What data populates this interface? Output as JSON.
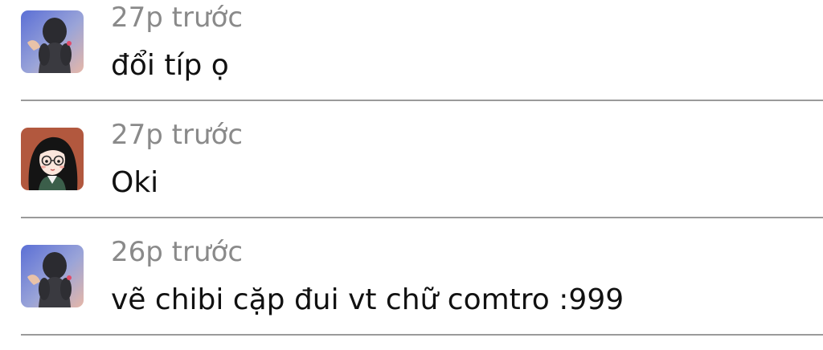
{
  "comments": [
    {
      "avatar": "user-photo-avatar",
      "time": "27p trước",
      "text": "đổi típ ọ"
    },
    {
      "avatar": "cartoon-girl-avatar",
      "time": "27p trước",
      "text": "Oki"
    },
    {
      "avatar": "user-photo-avatar",
      "time": "26p trước",
      "text": "vẽ chibi cặp đui vt chữ comtro :999"
    }
  ]
}
